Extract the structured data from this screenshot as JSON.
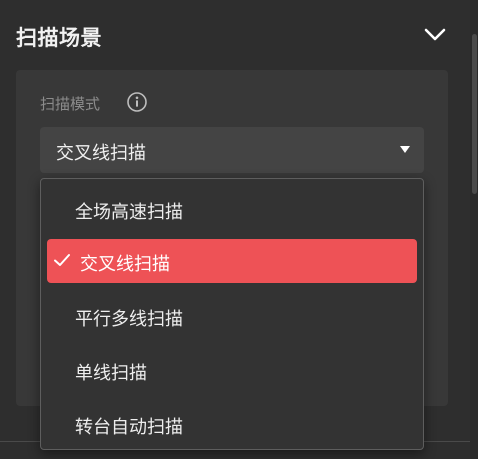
{
  "panel": {
    "title": "扫描场景",
    "collapse_icon": "chevron-down-icon"
  },
  "scan_mode": {
    "label": "扫描模式",
    "info_icon": "info-icon",
    "selected_value": "交叉线扫描",
    "options": [
      {
        "label": "全场高速扫描",
        "selected": false
      },
      {
        "label": "交叉线扫描",
        "selected": true
      },
      {
        "label": "平行多线扫描",
        "selected": false
      },
      {
        "label": "单线扫描",
        "selected": false
      },
      {
        "label": "转台自动扫描",
        "selected": false
      }
    ]
  },
  "colors": {
    "accent": "#ee5256",
    "background": "#2e2e2e",
    "card": "#383838",
    "select": "#444444"
  }
}
